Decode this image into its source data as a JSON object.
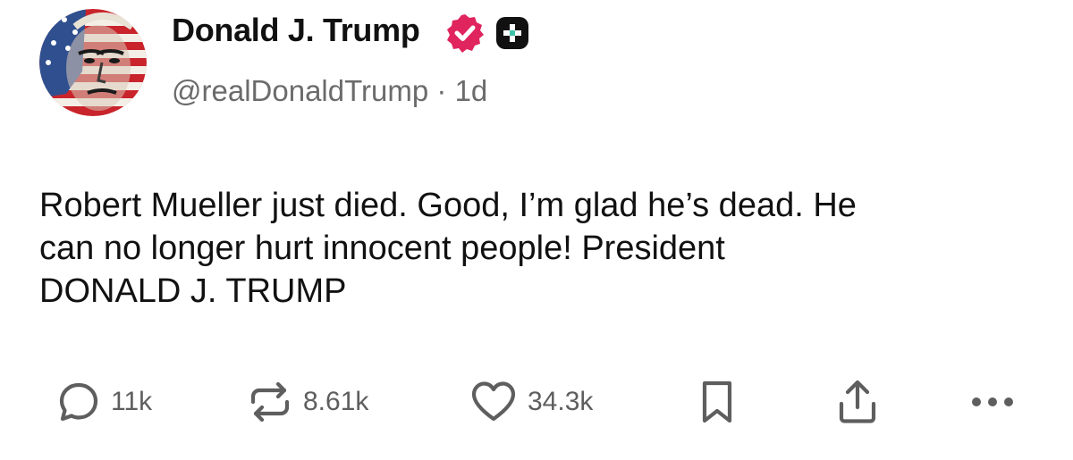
{
  "author": {
    "name": "Donald J. Trump",
    "handle": "@realDonaldTrump",
    "separator": "·",
    "time": "1d",
    "verified_color": "#e0245e",
    "badge_icon": "plus-square-icon"
  },
  "post": {
    "lines": [
      "Robert Mueller just died. Good, I’m glad he’s dead. He",
      "can no longer hurt innocent people! President",
      "DONALD J. TRUMP"
    ]
  },
  "actions": {
    "reply": {
      "icon": "reply-bubble-icon",
      "count": "11k"
    },
    "repost": {
      "icon": "repost-icon",
      "count": "8.61k"
    },
    "like": {
      "icon": "heart-icon",
      "count": "34.3k"
    },
    "bookmark": {
      "icon": "bookmark-icon"
    },
    "share": {
      "icon": "share-icon"
    },
    "more": {
      "icon": "more-horizontal-icon"
    }
  },
  "colors": {
    "text": "#111111",
    "muted": "#6b6b6b",
    "icon": "#5e5e5e",
    "verified": "#e0245e"
  }
}
